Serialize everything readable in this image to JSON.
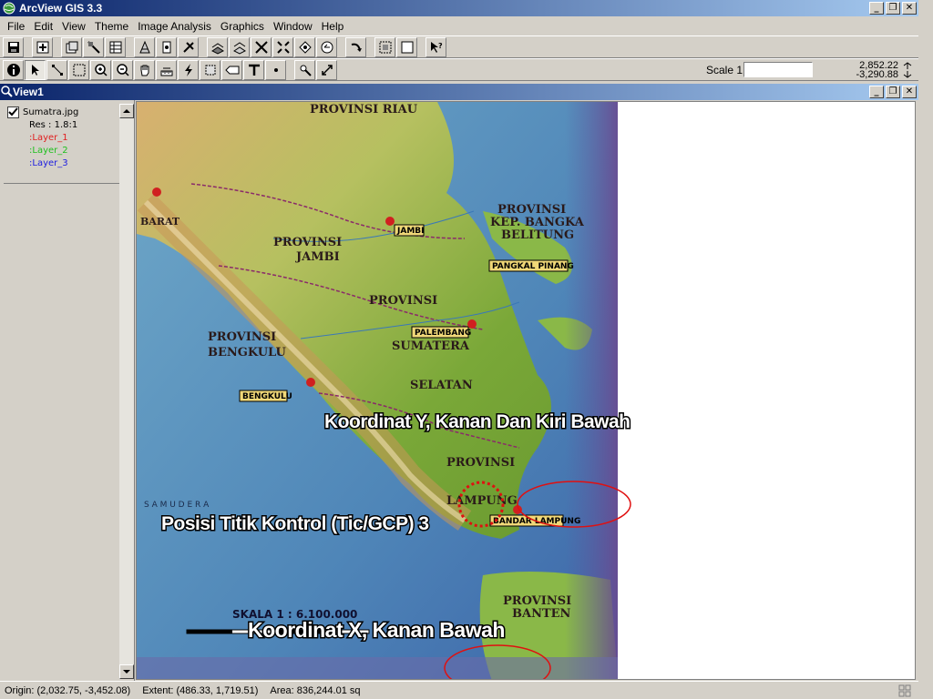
{
  "app": {
    "title": "ArcView GIS 3.3"
  },
  "menu": [
    "File",
    "Edit",
    "View",
    "Theme",
    "Image Analysis",
    "Graphics",
    "Window",
    "Help"
  ],
  "scale": {
    "label": "Scale 1:",
    "value": ""
  },
  "coords": {
    "x": "2,852.22",
    "y": "-3,290.88"
  },
  "view": {
    "title": "View1"
  },
  "toc": {
    "theme_name": "Sumatra.jpg",
    "res": "Res : 1.8:1",
    "layers": [
      {
        "label": ":Layer_1",
        "color": "#e02020"
      },
      {
        "label": ":Layer_2",
        "color": "#20c020"
      },
      {
        "label": ":Layer_3",
        "color": "#2020e0"
      }
    ]
  },
  "map": {
    "provinces": [
      "PROVINSI RIAU",
      "PROVINSI JAMBI",
      "PROVINSI SUMATERA SELATAN",
      "PROVINSI BENGKULU",
      "PROVINSI LAMPUNG",
      "PROVINSI KEP. BANGKA BELITUNG",
      "PROVINSI BANTEN"
    ],
    "cities": [
      "JAMBI",
      "PALEMBANG",
      "BENGKULU",
      "PANGKAL PINANG",
      "BANDAR LAMPUNG"
    ],
    "scale_text": "SKALA 1 : 6.100.000",
    "annotations": {
      "y": "Koordinat Y, Kanan Dan Kiri Bawah",
      "gcp": "Posisi Titik Kontrol (Tic/GCP) 3",
      "x": "Koordinat X, Kanan Bawah"
    }
  },
  "status": {
    "origin": "Origin: (2,032.75, -3,452.08)",
    "extent": "Extent: (486.33, 1,719.51)",
    "area": "Area: 836,244.01 sq"
  }
}
